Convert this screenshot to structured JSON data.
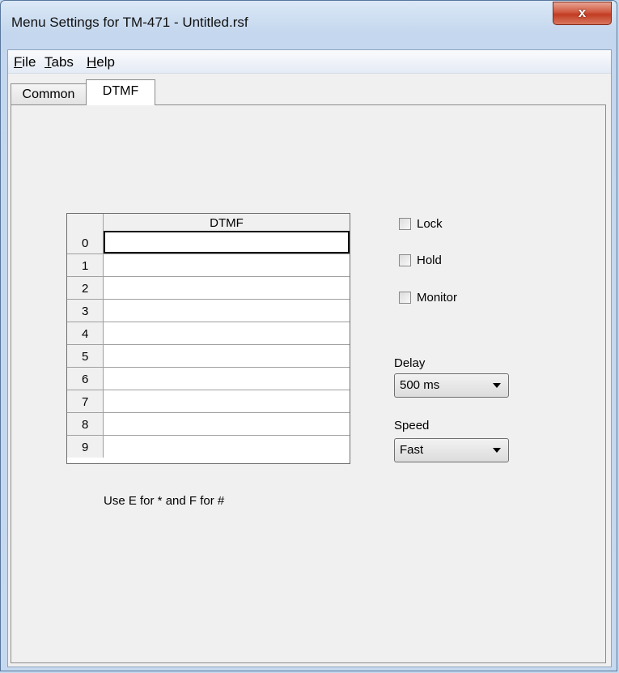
{
  "window": {
    "title": "Menu Settings for TM-471 - Untitled.rsf",
    "close_label": "x"
  },
  "menubar": {
    "items": [
      {
        "accel": "F",
        "rest": "ile"
      },
      {
        "accel": "T",
        "rest": "abs"
      },
      {
        "accel": "H",
        "rest": "elp"
      }
    ]
  },
  "tabs": [
    {
      "label": "Common",
      "active": false
    },
    {
      "label": "DTMF",
      "active": true
    }
  ],
  "grid": {
    "column_header": "DTMF",
    "rows": [
      {
        "index": "0",
        "value": ""
      },
      {
        "index": "1",
        "value": ""
      },
      {
        "index": "2",
        "value": ""
      },
      {
        "index": "3",
        "value": ""
      },
      {
        "index": "4",
        "value": ""
      },
      {
        "index": "5",
        "value": ""
      },
      {
        "index": "6",
        "value": ""
      },
      {
        "index": "7",
        "value": ""
      },
      {
        "index": "8",
        "value": ""
      },
      {
        "index": "9",
        "value": ""
      }
    ]
  },
  "options": {
    "lock": {
      "label": "Lock",
      "checked": false
    },
    "hold": {
      "label": "Hold",
      "checked": false
    },
    "monitor": {
      "label": "Monitor",
      "checked": false
    }
  },
  "delay": {
    "label": "Delay",
    "value": "500 ms"
  },
  "speed": {
    "label": "Speed",
    "value": "Fast"
  },
  "hint": "Use E for * and F for #"
}
